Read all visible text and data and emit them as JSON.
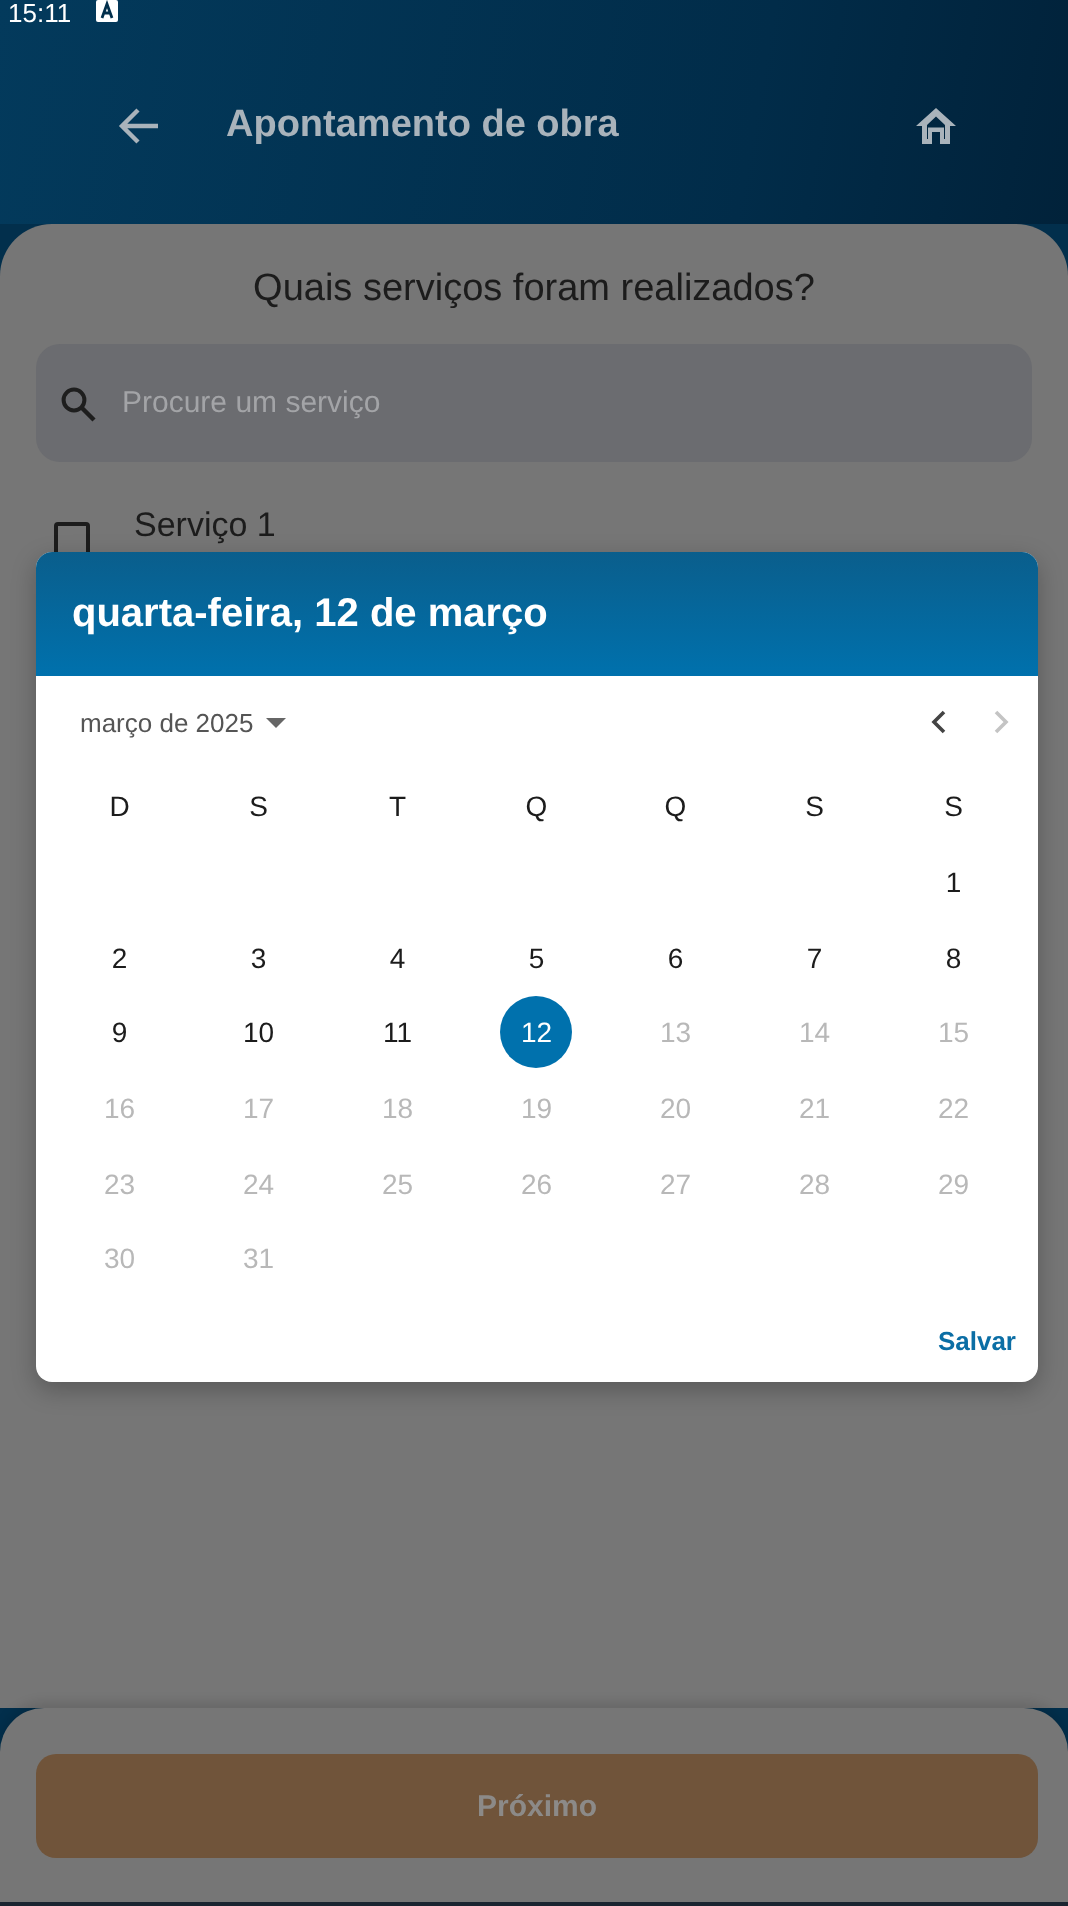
{
  "status_bar": {
    "time": "15:11"
  },
  "header": {
    "title": "Apontamento de obra"
  },
  "sheet": {
    "question": "Quais serviços foram realizados?",
    "search": {
      "placeholder": "Procure um serviço"
    },
    "services": [
      {
        "name": "Serviço 1",
        "checked": false
      }
    ]
  },
  "date_picker": {
    "title": "quarta-feira, 12 de março",
    "month_label": "março de 2025",
    "prev_disabled": false,
    "next_disabled": true,
    "weekdays": [
      "D",
      "S",
      "T",
      "Q",
      "Q",
      "S",
      "S"
    ],
    "weeks": [
      [
        {
          "day": "1",
          "selected": false,
          "disabled": false
        }
      ],
      [
        {
          "day": "2",
          "selected": false,
          "disabled": false
        },
        {
          "day": "3",
          "selected": false,
          "disabled": false
        },
        {
          "day": "4",
          "selected": false,
          "disabled": false
        },
        {
          "day": "5",
          "selected": false,
          "disabled": false
        },
        {
          "day": "6",
          "selected": false,
          "disabled": false
        },
        {
          "day": "7",
          "selected": false,
          "disabled": false
        },
        {
          "day": "8",
          "selected": false,
          "disabled": false
        }
      ],
      [
        {
          "day": "9",
          "selected": false,
          "disabled": false
        },
        {
          "day": "10",
          "selected": false,
          "disabled": false
        },
        {
          "day": "11",
          "selected": false,
          "disabled": false
        },
        {
          "day": "12",
          "selected": true,
          "disabled": false
        },
        {
          "day": "13",
          "selected": false,
          "disabled": true
        },
        {
          "day": "14",
          "selected": false,
          "disabled": true
        },
        {
          "day": "15",
          "selected": false,
          "disabled": true
        }
      ],
      [
        {
          "day": "16",
          "selected": false,
          "disabled": true
        },
        {
          "day": "17",
          "selected": false,
          "disabled": true
        },
        {
          "day": "18",
          "selected": false,
          "disabled": true
        },
        {
          "day": "19",
          "selected": false,
          "disabled": true
        },
        {
          "day": "20",
          "selected": false,
          "disabled": true
        },
        {
          "day": "21",
          "selected": false,
          "disabled": true
        },
        {
          "day": "22",
          "selected": false,
          "disabled": true
        }
      ],
      [
        {
          "day": "23",
          "selected": false,
          "disabled": true
        },
        {
          "day": "24",
          "selected": false,
          "disabled": true
        },
        {
          "day": "25",
          "selected": false,
          "disabled": true
        },
        {
          "day": "26",
          "selected": false,
          "disabled": true
        },
        {
          "day": "27",
          "selected": false,
          "disabled": true
        },
        {
          "day": "28",
          "selected": false,
          "disabled": true
        },
        {
          "day": "29",
          "selected": false,
          "disabled": true
        }
      ],
      [
        {
          "day": "30",
          "selected": false,
          "disabled": true
        },
        {
          "day": "31",
          "selected": false,
          "disabled": true
        }
      ]
    ],
    "save_button": "Salvar"
  },
  "footer": {
    "next_button": "Próximo"
  }
}
